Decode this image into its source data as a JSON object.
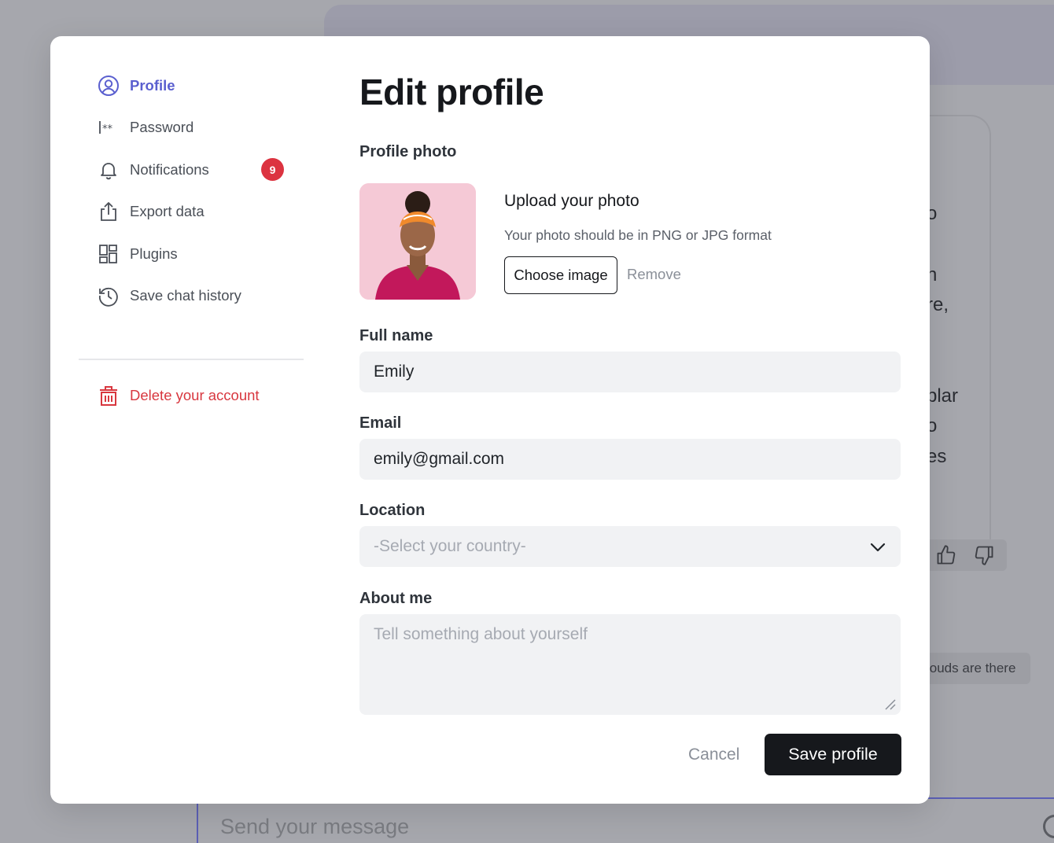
{
  "background": {
    "text_fragments": [
      "o",
      "n",
      "re,",
      "plar",
      "o",
      "es"
    ],
    "chip_label": "louds are there",
    "message_placeholder": "Send your message"
  },
  "sidebar": {
    "items": [
      {
        "label": "Profile",
        "icon": "user-circle-icon",
        "active": true
      },
      {
        "label": "Password",
        "icon": "password-icon"
      },
      {
        "label": "Notifications",
        "icon": "bell-icon",
        "badge": "9"
      },
      {
        "label": "Export data",
        "icon": "export-icon"
      },
      {
        "label": "Plugins",
        "icon": "plugins-grid-icon"
      },
      {
        "label": "Save chat history",
        "icon": "history-icon"
      }
    ],
    "danger_item": {
      "label": "Delete your account",
      "icon": "trash-icon"
    }
  },
  "form": {
    "title": "Edit profile",
    "photo_section_label": "Profile photo",
    "upload_title": "Upload your photo",
    "upload_hint": "Your photo should be in PNG or JPG format",
    "choose_label": "Choose image",
    "remove_label": "Remove",
    "full_name_label": "Full name",
    "full_name_value": "Emily",
    "email_label": "Email",
    "email_value": "emily@gmail.com",
    "location_label": "Location",
    "location_placeholder": "-Select your country-",
    "about_label": "About me",
    "about_placeholder": "Tell something about yourself",
    "cancel_label": "Cancel",
    "save_label": "Save profile"
  },
  "colors": {
    "accent": "#5a5fcf",
    "danger": "#dc3340",
    "primary_button": "#16181c",
    "field_bg": "#f1f2f4"
  }
}
